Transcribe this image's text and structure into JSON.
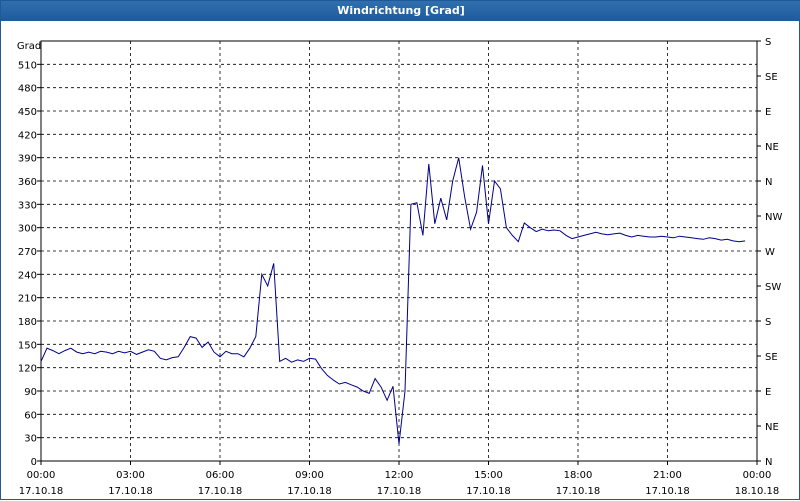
{
  "window": {
    "title": "Windrichtung [Grad]"
  },
  "chart_data": {
    "type": "line",
    "title": "Windrichtung [Grad]",
    "ylabel": "Grad",
    "ylim": [
      0,
      540
    ],
    "yticks": [
      0,
      30,
      60,
      90,
      120,
      150,
      180,
      210,
      240,
      270,
      300,
      330,
      360,
      390,
      420,
      450,
      480,
      510
    ],
    "right_axis_labels": [
      "N",
      "NE",
      "E",
      "SE",
      "S",
      "SW",
      "W",
      "NW",
      "N",
      "NE",
      "E",
      "SE",
      "S"
    ],
    "xlim": [
      0,
      24
    ],
    "x_unit": "hours since 17.10.18 00:00",
    "xticks": [
      {
        "time": "00:00",
        "date": "17.10.18"
      },
      {
        "time": "03:00",
        "date": "17.10.18"
      },
      {
        "time": "06:00",
        "date": "17.10.18"
      },
      {
        "time": "09:00",
        "date": "17.10.18"
      },
      {
        "time": "12:00",
        "date": "17.10.18"
      },
      {
        "time": "15:00",
        "date": "17.10.18"
      },
      {
        "time": "18:00",
        "date": "17.10.18"
      },
      {
        "time": "21:00",
        "date": "17.10.18"
      },
      {
        "time": "00:00",
        "date": "18.10.18"
      }
    ],
    "grid": true,
    "series": [
      {
        "color": "#00008b",
        "x": [
          0.0,
          0.2,
          0.4,
          0.6,
          0.8,
          1.0,
          1.2,
          1.4,
          1.6,
          1.8,
          2.0,
          2.2,
          2.4,
          2.6,
          2.8,
          3.0,
          3.2,
          3.4,
          3.6,
          3.8,
          4.0,
          4.2,
          4.4,
          4.6,
          4.8,
          5.0,
          5.2,
          5.4,
          5.6,
          5.8,
          6.0,
          6.2,
          6.4,
          6.6,
          6.8,
          7.0,
          7.2,
          7.4,
          7.6,
          7.8,
          8.0,
          8.2,
          8.4,
          8.6,
          8.8,
          9.0,
          9.2,
          9.4,
          9.6,
          9.8,
          10.0,
          10.2,
          10.4,
          10.6,
          10.8,
          11.0,
          11.2,
          11.4,
          11.6,
          11.8,
          12.0,
          12.2,
          12.4,
          12.6,
          12.8,
          13.0,
          13.2,
          13.4,
          13.6,
          13.8,
          14.0,
          14.2,
          14.4,
          14.6,
          14.8,
          15.0,
          15.2,
          15.4,
          15.6,
          15.8,
          16.0,
          16.2,
          16.4,
          16.6,
          16.8,
          17.0,
          17.2,
          17.4,
          17.6,
          17.8,
          18.0,
          18.2,
          18.4,
          18.6,
          18.8,
          19.0,
          19.2,
          19.4,
          19.6,
          19.8,
          20.0,
          20.2,
          20.4,
          20.6,
          20.8,
          21.0,
          21.2,
          21.4,
          21.6,
          21.8,
          22.0,
          22.2,
          22.4,
          22.6,
          22.8,
          23.0,
          23.2,
          23.4,
          23.6
        ],
        "values": [
          128,
          145,
          142,
          138,
          142,
          145,
          140,
          138,
          140,
          138,
          141,
          140,
          138,
          141,
          139,
          141,
          137,
          140,
          143,
          141,
          132,
          130,
          133,
          134,
          146,
          160,
          158,
          146,
          153,
          140,
          134,
          141,
          138,
          138,
          134,
          145,
          160,
          240,
          225,
          254,
          128,
          132,
          127,
          130,
          128,
          132,
          131,
          119,
          110,
          104,
          99,
          101,
          98,
          95,
          90,
          87,
          106,
          95,
          78,
          96,
          22,
          90,
          330,
          332,
          290,
          382,
          305,
          338,
          310,
          360,
          390,
          340,
          298,
          320,
          380,
          305,
          360,
          350,
          300,
          290,
          282,
          306,
          300,
          295,
          298,
          296,
          297,
          296,
          290,
          286,
          288,
          290,
          292,
          294,
          292,
          291,
          292,
          293,
          290,
          288,
          290,
          289,
          288,
          288,
          289,
          288,
          287,
          289,
          288,
          287,
          286,
          285,
          287,
          286,
          284,
          285,
          283,
          282,
          283
        ]
      }
    ]
  }
}
